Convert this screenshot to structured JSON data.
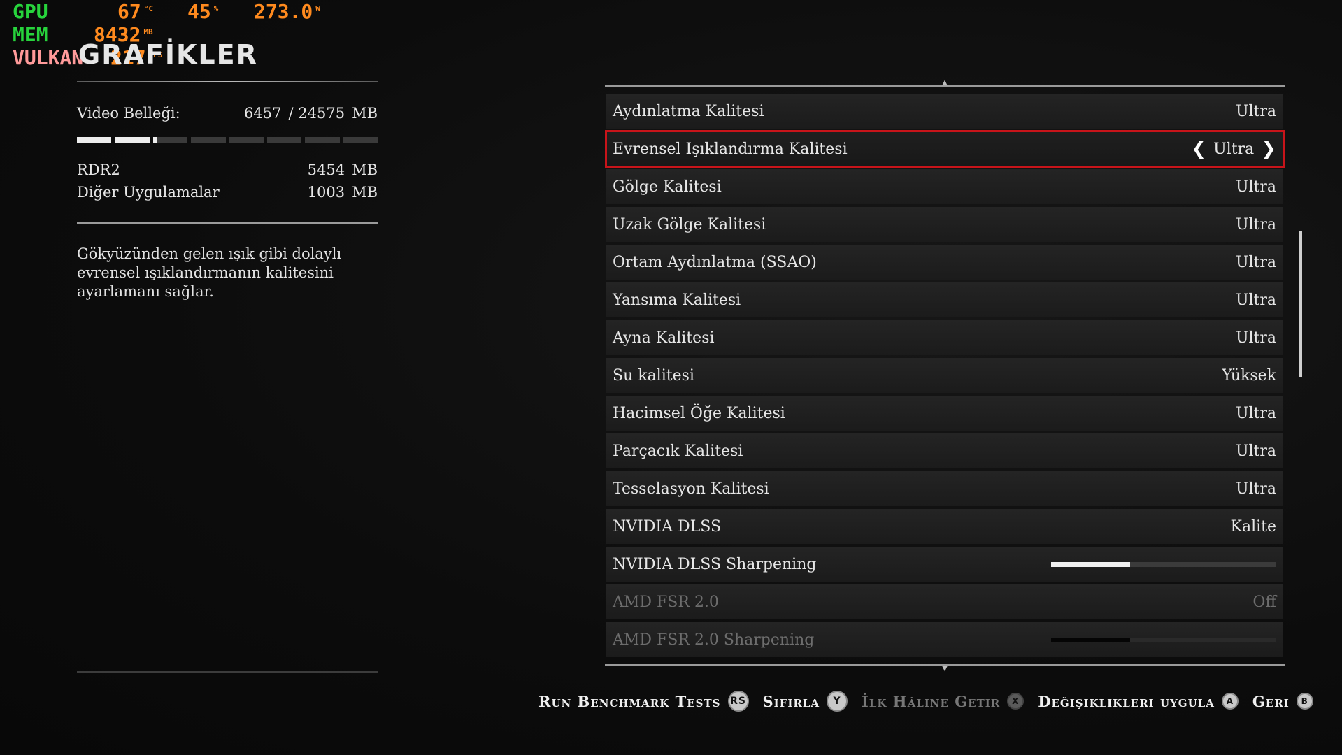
{
  "osd": {
    "gpu_label": "GPU",
    "gpu_temp": "67",
    "gpu_temp_unit": "°C",
    "gpu_load": "45",
    "gpu_load_unit": "%",
    "gpu_power": "273.0",
    "gpu_power_unit": "W",
    "mem_label": "MEM",
    "mem_value": "8432",
    "mem_unit": "MB",
    "api_label": "VULKAN",
    "fps": "217",
    "fps_unit": "FPS"
  },
  "page_title": "GRAFİKLER",
  "memory": {
    "label": "Video Belleği:",
    "used": "6457",
    "total": "/ 24575",
    "unit": "MB",
    "usage_fraction": 0.263,
    "usage": [
      {
        "name": "RDR2",
        "value": "5454",
        "unit": "MB"
      },
      {
        "name": "Diğer Uygulamalar",
        "value": "1003",
        "unit": "MB"
      }
    ]
  },
  "description": "Gökyüzünden gelen ışık gibi dolaylı evrensel ışıklandırmanın kalitesini ayarlamanı sağlar.",
  "settings": [
    {
      "label": "Aydınlatma Kalitesi",
      "value": "Ultra"
    },
    {
      "label": "Evrensel Işıklandırma Kalitesi",
      "value": "Ultra",
      "selected": true
    },
    {
      "label": "Gölge Kalitesi",
      "value": "Ultra"
    },
    {
      "label": "Uzak Gölge Kalitesi",
      "value": "Ultra"
    },
    {
      "label": "Ortam Aydınlatma (SSAO)",
      "value": "Ultra"
    },
    {
      "label": "Yansıma Kalitesi",
      "value": "Ultra"
    },
    {
      "label": "Ayna Kalitesi",
      "value": "Ultra"
    },
    {
      "label": "Su kalitesi",
      "value": "Yüksek"
    },
    {
      "label": "Hacimsel Öğe Kalitesi",
      "value": "Ultra"
    },
    {
      "label": "Parçacık Kalitesi",
      "value": "Ultra"
    },
    {
      "label": "Tesselasyon Kalitesi",
      "value": "Ultra"
    },
    {
      "label": "NVIDIA DLSS",
      "value": "Kalite"
    },
    {
      "label": "NVIDIA DLSS Sharpening",
      "slider": 0.35
    },
    {
      "label": "AMD FSR 2.0",
      "value": "Off",
      "disabled": true
    },
    {
      "label": "AMD FSR 2.0 Sharpening",
      "slider": 0.35,
      "disabled": true
    }
  ],
  "hints": [
    {
      "label": "Run Benchmark Tests",
      "button": "RS"
    },
    {
      "label": "Sıfırla",
      "button": "Y"
    },
    {
      "label": "İlk Hâline Getir",
      "button": "X",
      "disabled": true
    },
    {
      "label": "Değişiklikleri uygula",
      "button": "A"
    },
    {
      "label": "Geri",
      "button": "B"
    }
  ]
}
